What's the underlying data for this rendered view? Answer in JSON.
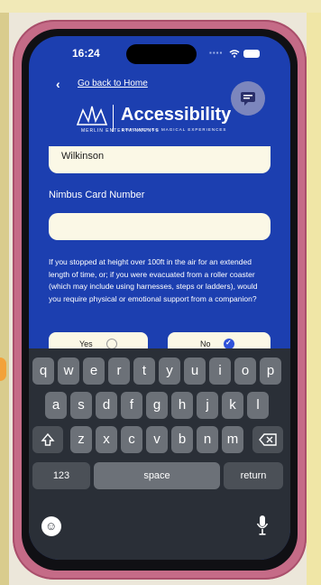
{
  "status_bar": {
    "time": "16:24"
  },
  "nav": {
    "back_label": "Go back to Home"
  },
  "logo": {
    "brand": "MERLIN ENTERTAINMENTS",
    "title": "Accessibility",
    "subtitle": "EMPOWERING MAGICAL EXPERIENCES"
  },
  "form": {
    "surname_value": "Wilkinson",
    "card_label": "Nimbus Card Number",
    "card_value": "",
    "question": "If you stopped at height over 100ft in the air for an extended length of time, or; if you were evacuated from a roller coaster (which may include using harnesses, steps or ladders), would you require physical or emotional support from a companion?",
    "options": [
      {
        "label": "Yes",
        "selected": false
      },
      {
        "label": "No",
        "selected": true
      }
    ]
  },
  "keyboard": {
    "row1": [
      "q",
      "w",
      "e",
      "r",
      "t",
      "y",
      "u",
      "i",
      "o",
      "p"
    ],
    "row2": [
      "a",
      "s",
      "d",
      "f",
      "g",
      "h",
      "j",
      "k",
      "l"
    ],
    "row3": [
      "z",
      "x",
      "c",
      "v",
      "b",
      "n",
      "m"
    ],
    "numbers_key": "123",
    "space_key": "space",
    "return_key": "return"
  },
  "colors": {
    "screen_bg": "#1c3fb0",
    "field_bg": "#fbf8e6",
    "selected_radio": "#2f52d9",
    "case": "#c56b87"
  },
  "icons": [
    "back-chevron-icon",
    "chat-icon",
    "shift-icon",
    "backspace-icon",
    "emoji-icon",
    "microphone-icon",
    "wifi-icon",
    "battery-icon",
    "signal-icon"
  ]
}
